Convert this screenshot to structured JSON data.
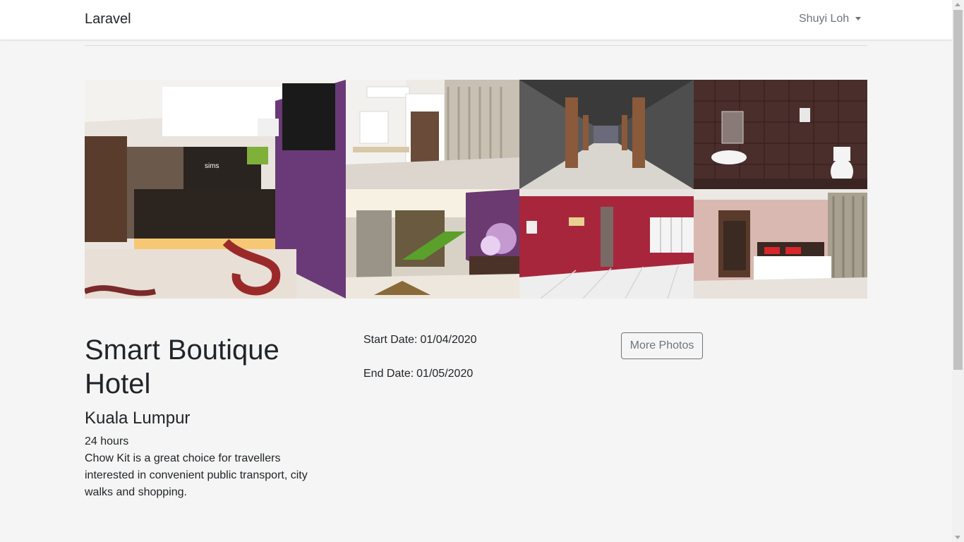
{
  "navbar": {
    "brand": "Laravel",
    "user_name": "Shuyi Loh"
  },
  "gallery": {
    "photos": [
      {
        "name": "lobby-reception-photo",
        "sign": "sims"
      },
      {
        "name": "room-closet-photo"
      },
      {
        "name": "corridor-photo"
      },
      {
        "name": "bathroom-photo"
      },
      {
        "name": "lobby-stairs-photo"
      },
      {
        "name": "red-wall-room-photo"
      },
      {
        "name": "bedroom-photo"
      }
    ]
  },
  "hotel": {
    "name": "Smart Boutique Hotel",
    "city": "Kuala Lumpur",
    "hours": "24 hours",
    "description": "Chow Kit is a great choice for travellers interested in convenient public transport, city walks and shopping."
  },
  "booking": {
    "start_label": "Start Date:",
    "start_value": "01/04/2020",
    "end_label": "End Date:",
    "end_value": "01/05/2020"
  },
  "actions": {
    "more_photos_label": "More Photos"
  },
  "colors": {
    "page_bg": "#f5f5f5",
    "navbar_bg": "#ffffff",
    "muted_text": "#6c757d",
    "text": "#212529"
  }
}
